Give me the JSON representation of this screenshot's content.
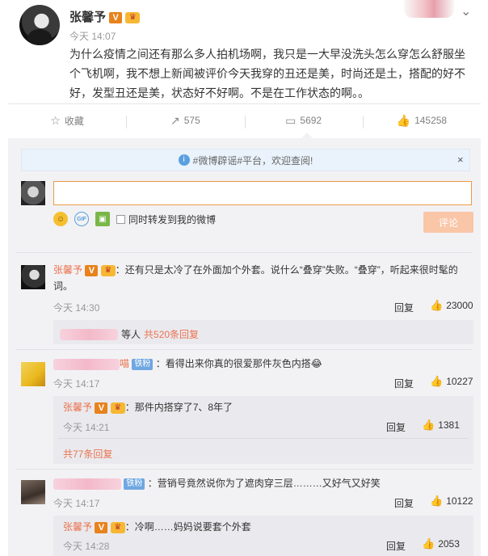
{
  "post": {
    "author": "张馨予",
    "vip_badge": "V",
    "crown_badge": "♛",
    "time": "今天 14:07",
    "text": "为什么疫情之间还有那么多人拍机场啊，我只是一大早没洗头怎么穿怎么舒服坐个飞机啊，我不想上新闻被评价今天我穿的丑还是美，时尚还是土，搭配的好不好，发型丑还是美，状态好不好啊。不是在工作状态的啊。。",
    "chevron_icon": "chevron-down-icon"
  },
  "actions": {
    "favorite_label": "收藏",
    "repost_count": "575",
    "comment_count": "5692",
    "like_count": "145258"
  },
  "notice": {
    "text": "#微博辟谣#平台，欢迎查阅!",
    "close": "×"
  },
  "composer": {
    "input_value": "",
    "also_repost_label": "同时转发到我的微博",
    "submit_label": "评论"
  },
  "comments": [
    {
      "name": "张馨予",
      "text": "：还有只是太冷了在外面加个外套。说什么“叠穿”失败。“叠穿”，听起来很时髦的词。",
      "time": "今天 14:30",
      "reply": "回复",
      "likes": "23000",
      "summary_prefix": "等人",
      "summary_link": "共520条回复"
    },
    {
      "name_suffix": "喵",
      "tiefen": "铁粉",
      "text": "：看得出来你真的很爱那件灰色内搭😂",
      "time": "今天 14:17",
      "reply": "回复",
      "likes": "10227",
      "sub": {
        "name": "张馨予",
        "text": "：那件内搭穿了7、8年了",
        "time": "今天 14:21",
        "reply": "回复",
        "likes": "1381"
      },
      "more_link": "共77条回复"
    },
    {
      "tiefen": "铁粉",
      "text": "：营销号竟然说你为了遮肉穿三层………又好气又好笑",
      "time": "今天 14:17",
      "reply": "回复",
      "likes": "10122",
      "sub": {
        "name": "张馨予",
        "text": "：冷啊……妈妈说要套个外套",
        "time": "今天 14:28",
        "reply": "回复",
        "likes": "2053"
      }
    }
  ]
}
